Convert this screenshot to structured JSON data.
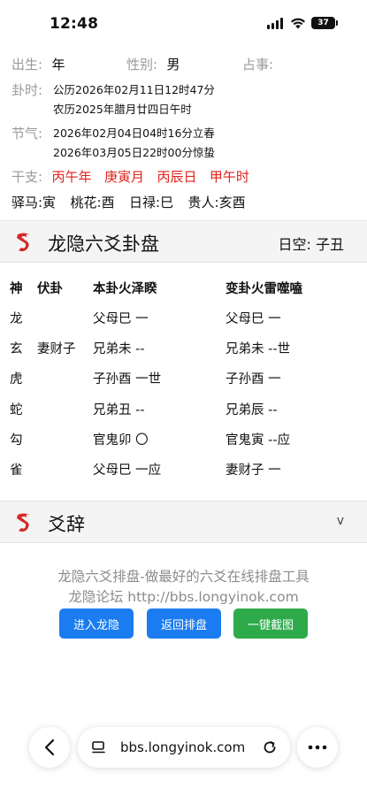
{
  "status_bar": {
    "time": "12:48",
    "battery": "37"
  },
  "info": {
    "birth_label": "出生:",
    "birth_value": "年",
    "gender_label": "性别:",
    "gender_value": "男",
    "divination_label": "占事:",
    "gua_time_label": "卦时:",
    "gua_time_solar": "公历2026年02月11日12时47分",
    "gua_time_lunar": "农历2025年腊月廿四日午时",
    "solar_term_label": "节气:",
    "solar_term_1": "2026年02月04日04时16分立春",
    "solar_term_2": "2026年03月05日22时00分惊蛰",
    "ganzhi_label": "干支:",
    "ganzhi": [
      "丙午年",
      "庚寅月",
      "丙辰日",
      "甲午时"
    ],
    "extras": [
      "驿马:寅",
      "桃花:酉",
      "日禄:巳",
      "贵人:亥酉"
    ]
  },
  "gua_panel": {
    "title": "龙隐六爻卦盘",
    "rikong": "日空:  子丑"
  },
  "gua_table": {
    "headers": [
      "神",
      "伏卦",
      "本卦火泽睽",
      "变卦火雷噬嗑"
    ],
    "rows": [
      {
        "shen": "龙",
        "fu": "",
        "ben": "父母巳 一",
        "bian": "父母巳 一"
      },
      {
        "shen": "玄",
        "fu": "妻财子",
        "ben": "兄弟未 --",
        "bian": "兄弟未 --世"
      },
      {
        "shen": "虎",
        "fu": "",
        "ben": "子孙酉 一世",
        "bian": "子孙酉 一"
      },
      {
        "shen": "蛇",
        "fu": "",
        "ben": "兄弟丑 --",
        "bian": "兄弟辰 --"
      },
      {
        "shen": "勾",
        "fu": "",
        "ben": "官鬼卯 〇",
        "bian": "官鬼寅 --应"
      },
      {
        "shen": "雀",
        "fu": "",
        "ben": "父母巳 一应",
        "bian": "妻财子 一"
      }
    ]
  },
  "yaoci_panel": {
    "title": "爻辞",
    "toggle": "v"
  },
  "footer": {
    "line1": "龙隐六爻排盘-做最好的六爻在线排盘工具",
    "line2": "龙隐论坛 http://bbs.longyinok.com",
    "buttons": [
      "进入龙隐",
      "返回排盘",
      "一键截图"
    ]
  },
  "browser": {
    "url": "bbs.longyinok.com"
  },
  "colors": {
    "red": "#e0221b",
    "blue": "#1a7cf0",
    "green": "#2eaa4b"
  }
}
